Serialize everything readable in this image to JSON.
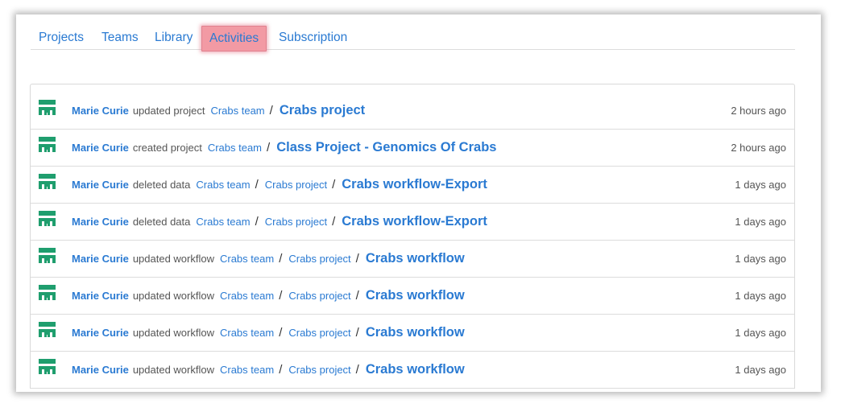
{
  "tabs": [
    {
      "label": "Projects",
      "active": false
    },
    {
      "label": "Teams",
      "active": false
    },
    {
      "label": "Library",
      "active": false
    },
    {
      "label": "Activities",
      "active": true
    },
    {
      "label": "Subscription",
      "active": false
    }
  ],
  "colors": {
    "link": "#2a7ad2",
    "avatar": "#1f9e6e",
    "highlight": "#f29aa4"
  },
  "activities": [
    {
      "user": "Marie Curie",
      "action": "updated project",
      "path": [
        "Crabs team"
      ],
      "target": "Crabs project",
      "time": "2 hours ago"
    },
    {
      "user": "Marie Curie",
      "action": "created project",
      "path": [
        "Crabs team"
      ],
      "target": "Class Project - Genomics Of Crabs",
      "time": "2 hours ago"
    },
    {
      "user": "Marie Curie",
      "action": "deleted data",
      "path": [
        "Crabs team",
        "Crabs project"
      ],
      "target": "Crabs workflow-Export",
      "time": "1 days ago"
    },
    {
      "user": "Marie Curie",
      "action": "deleted data",
      "path": [
        "Crabs team",
        "Crabs project"
      ],
      "target": "Crabs workflow-Export",
      "time": "1 days ago"
    },
    {
      "user": "Marie Curie",
      "action": "updated workflow",
      "path": [
        "Crabs team",
        "Crabs project"
      ],
      "target": "Crabs workflow",
      "time": "1 days ago"
    },
    {
      "user": "Marie Curie",
      "action": "updated workflow",
      "path": [
        "Crabs team",
        "Crabs project"
      ],
      "target": "Crabs workflow",
      "time": "1 days ago"
    },
    {
      "user": "Marie Curie",
      "action": "updated workflow",
      "path": [
        "Crabs team",
        "Crabs project"
      ],
      "target": "Crabs workflow",
      "time": "1 days ago"
    },
    {
      "user": "Marie Curie",
      "action": "updated workflow",
      "path": [
        "Crabs team",
        "Crabs project"
      ],
      "target": "Crabs workflow",
      "time": "1 days ago"
    }
  ]
}
